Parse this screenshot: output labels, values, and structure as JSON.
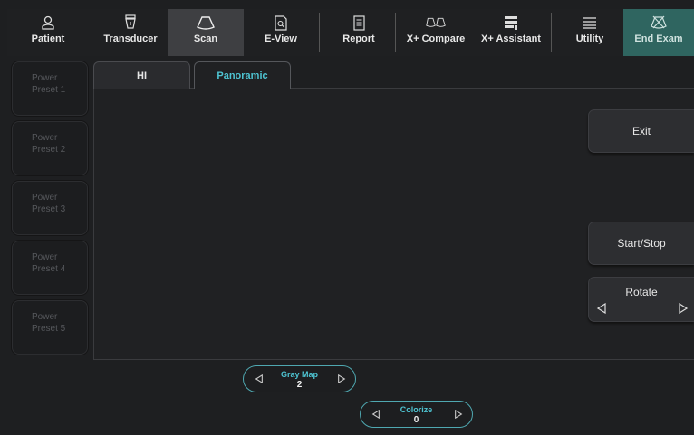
{
  "topbar": {
    "tabs": [
      {
        "label": "Patient",
        "icon": "patient-icon"
      },
      {
        "label": "Transducer",
        "icon": "transducer-icon"
      },
      {
        "label": "Scan",
        "icon": "scan-icon"
      },
      {
        "label": "E-View",
        "icon": "eview-icon"
      },
      {
        "label": "Report",
        "icon": "report-icon"
      },
      {
        "label": "X+ Compare",
        "icon": "compare-icon"
      },
      {
        "label": "X+ Assistant",
        "icon": "assistant-icon"
      },
      {
        "label": "Utility",
        "icon": "utility-icon"
      },
      {
        "label": "End Exam",
        "icon": "end-exam-icon"
      }
    ],
    "active": "Scan",
    "colors": {
      "active_bg": "#3e3f42",
      "end_exam_bg": "#2f6560"
    }
  },
  "presets": [
    {
      "line1": "Power",
      "line2": "Preset 1"
    },
    {
      "line1": "Power",
      "line2": "Preset 2"
    },
    {
      "line1": "Power",
      "line2": "Preset 3"
    },
    {
      "line1": "Power",
      "line2": "Preset 4"
    },
    {
      "line1": "Power",
      "line2": "Preset 5"
    }
  ],
  "tabs": {
    "hi": "HI",
    "panoramic": "Panoramic",
    "active": "Panoramic"
  },
  "buttons": {
    "exit": "Exit",
    "start_stop": "Start/Stop",
    "rotate": "Rotate"
  },
  "controls": {
    "gray_map": {
      "label": "Gray Map",
      "value": "2"
    },
    "colorize": {
      "label": "Colorize",
      "value": "0"
    }
  },
  "accent": "#4ec4d2"
}
